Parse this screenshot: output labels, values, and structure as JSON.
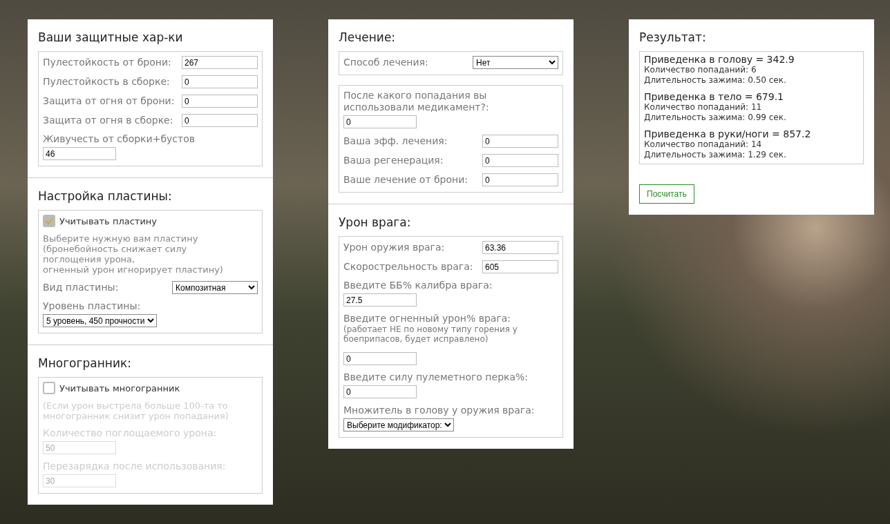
{
  "panels": [
    {
      "sections": [
        {
          "title": "Ваши защитные хар-ки",
          "groups": [
            {
              "disabled": false,
              "items": [
                {
                  "kind": "inline_input",
                  "label": "Пулестойкость от брони:",
                  "value": "267"
                },
                {
                  "kind": "inline_input",
                  "label": "Пулестойкость в сборке:",
                  "value": "0"
                },
                {
                  "kind": "inline_input",
                  "label": "Защита от огня от брони:",
                  "value": "0"
                },
                {
                  "kind": "inline_input",
                  "label": "Защита от огня в сборке:",
                  "value": "0"
                },
                {
                  "kind": "stacked_input",
                  "label": "Живучесть от сборки+бустов",
                  "value": "46"
                }
              ]
            }
          ]
        },
        {
          "title": "Настройка пластины:",
          "groups": [
            {
              "disabled": false,
              "items": [
                {
                  "kind": "checkbox",
                  "label": "Учитывать пластину",
                  "checked": true
                },
                {
                  "kind": "note",
                  "text": "Выберите нужную вам пластину\n(бронебойность снижает силу\nпоглощения урона,\nогненный урон игнорирует пластину)"
                },
                {
                  "kind": "inline_select",
                  "label": "Вид пластины:",
                  "value": "Композитная"
                },
                {
                  "kind": "stacked_select",
                  "label": "Уровень пластины:",
                  "value": "5 уровень, 450 прочности"
                }
              ]
            }
          ]
        },
        {
          "title": "Многогранник:",
          "groups": [
            {
              "disabled": true,
              "items": [
                {
                  "kind": "checkbox",
                  "label": "Учитывать многогранник",
                  "checked": false
                },
                {
                  "kind": "note",
                  "text": "(Если урон выстрела больше 100-та то\nмногогранник снизит урон попадания)"
                },
                {
                  "kind": "stacked_input",
                  "label": "Количество поглощаемого урона:",
                  "value": "50"
                },
                {
                  "kind": "stacked_input",
                  "label": "Перезарядка после использования:",
                  "value": "30"
                }
              ]
            }
          ]
        }
      ]
    },
    {
      "sections": [
        {
          "title": "Лечение:",
          "groups": [
            {
              "disabled": false,
              "items": [
                {
                  "kind": "inline_select",
                  "label": "Способ лечения:",
                  "value": "Нет"
                }
              ]
            },
            {
              "disabled": false,
              "items": [
                {
                  "kind": "stacked_input",
                  "label": "После какого попадания вы\nиспользовали медикамент?:",
                  "value": "0"
                },
                {
                  "kind": "inline_input",
                  "label": "Ваша эфф. лечения:",
                  "value": "0"
                },
                {
                  "kind": "inline_input",
                  "label": "Ваша регенерация:",
                  "value": "0"
                },
                {
                  "kind": "inline_input",
                  "label": "Ваше лечение от брони:",
                  "value": "0"
                }
              ]
            }
          ]
        },
        {
          "title": "Урон врага:",
          "groups": [
            {
              "disabled": false,
              "items": [
                {
                  "kind": "inline_input",
                  "label": "Урон оружия врага:",
                  "value": "63.36"
                },
                {
                  "kind": "inline_input",
                  "label": "Скорострельность врага:",
                  "value": "605"
                },
                {
                  "kind": "stacked_input",
                  "label": "Введите ББ% калибра врага:",
                  "value": "27.5"
                },
                {
                  "kind": "label",
                  "label": "Введите огненный урон% врага:"
                },
                {
                  "kind": "small_note",
                  "text": "(работает НЕ по новому типу горения у\nбоеприпасов, будет исправлено)"
                },
                {
                  "kind": "bare_input",
                  "value": "0"
                },
                {
                  "kind": "stacked_input",
                  "label": "Введите силу пулеметного перка%:",
                  "value": "0"
                },
                {
                  "kind": "stacked_select",
                  "label": "Множитель в голову у оружия врага:",
                  "value": "Выберите модификатор:"
                }
              ]
            }
          ]
        }
      ]
    }
  ],
  "result_panel": {
    "title": "Результат:",
    "entries": [
      {
        "heading": "Приведенка в голову = 342.9",
        "hits": "Количество попаданий: 6",
        "duration": "Длительность зажима: 0.50 сек."
      },
      {
        "heading": "Приведенка в тело = 679.1",
        "hits": "Количество попаданий: 11",
        "duration": "Длительность зажима: 0.99 сек."
      },
      {
        "heading": "Приведенка в руки/ноги = 857.2",
        "hits": "Количество попаданий: 14",
        "duration": "Длительность зажима: 1.29 сек."
      }
    ],
    "button": "Посчитать"
  }
}
